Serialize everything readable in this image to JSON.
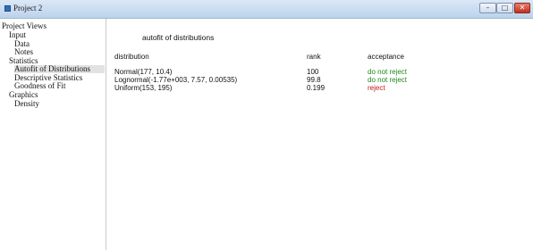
{
  "window": {
    "title": "Project 2"
  },
  "controls": {
    "minimize": "–",
    "maximize": "□",
    "close": "✕"
  },
  "sidebar": {
    "root": "Project Views",
    "input": "Input",
    "data": "Data",
    "notes": "Notes",
    "statistics": "Statistics",
    "autofit": "Autofit of Distributions",
    "descriptive": "Descriptive Statistics",
    "goodness": "Goodness of Fit",
    "graphics": "Graphics",
    "density": "Density"
  },
  "report": {
    "title": "autofit of distributions",
    "headers": {
      "distribution": "distribution",
      "rank": "rank",
      "acceptance": "acceptance"
    },
    "rows": [
      {
        "distribution": "Normal(177, 10.4)",
        "rank": "100",
        "acceptance": "do not reject"
      },
      {
        "distribution": "Lognormal(-1.77e+003, 7.57, 0.00535)",
        "rank": "99.8",
        "acceptance": "do not reject"
      },
      {
        "distribution": "Uniform(153, 195)",
        "rank": "0.199",
        "acceptance": "reject"
      }
    ]
  },
  "colors": {
    "accept": "#1e8a1e",
    "reject": "#c21a1a"
  }
}
